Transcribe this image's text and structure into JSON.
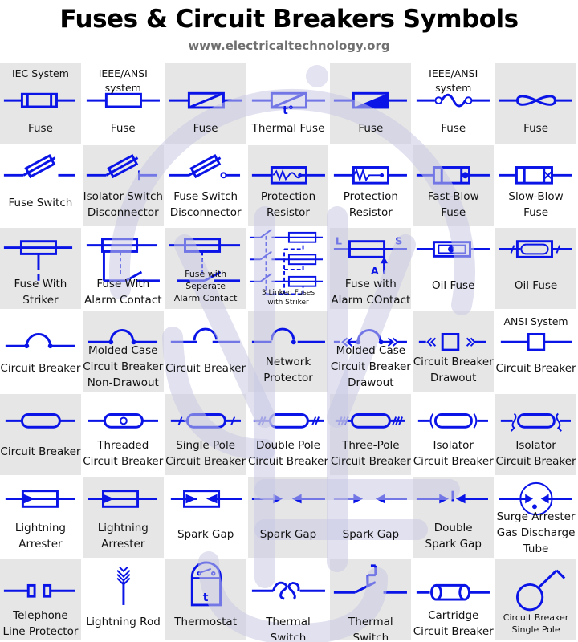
{
  "header": {
    "title": "Fuses & Circuit Breakers Symbols",
    "subtitle": "www.electricaltechnology.org"
  },
  "colors": {
    "symbol_blue": "#0a14e6",
    "cell_gray": "#e6e6e6",
    "cell_white": "#ffffff",
    "watermark": "#d4d4e8",
    "subtitle_gray": "#707070"
  },
  "cells": [
    {
      "icon": "iec-fuse-icon",
      "note": "IEC System",
      "label": "Fuse"
    },
    {
      "icon": "ieee-fuse-icon",
      "note": "IEEE/ANSI\nsystem",
      "label": "Fuse"
    },
    {
      "icon": "diagonal-fuse-icon",
      "note": "",
      "label": "Fuse"
    },
    {
      "icon": "thermal-fuse-icon",
      "note": "",
      "label": "Thermal Fuse",
      "sublabel": "t°"
    },
    {
      "icon": "filled-fuse-icon",
      "note": "",
      "label": "Fuse"
    },
    {
      "icon": "wave-fuse-icon",
      "note": "IEEE/ANSI\nsystem",
      "label": "Fuse"
    },
    {
      "icon": "bowtie-fuse-icon",
      "note": "",
      "label": "Fuse"
    },
    {
      "icon": "fuse-switch-icon",
      "note": "",
      "label": "Fuse Switch"
    },
    {
      "icon": "isolator-switch-icon",
      "note": "",
      "label": "Isolator Switch\nDisconnector"
    },
    {
      "icon": "fuse-switch-disconnector-icon",
      "note": "",
      "label": "Fuse Switch\nDisconnector"
    },
    {
      "icon": "protection-resistor-wave-icon",
      "note": "",
      "label": "Protection\nResistor"
    },
    {
      "icon": "protection-resistor-zigzag-icon",
      "note": "",
      "label": "Protection\nResistor"
    },
    {
      "icon": "fast-blow-fuse-icon",
      "note": "",
      "label": "Fast-Blow\nFuse"
    },
    {
      "icon": "slow-blow-fuse-icon",
      "note": "",
      "label": "Slow-Blow\nFuse"
    },
    {
      "icon": "fuse-striker-icon",
      "note": "",
      "label": "Fuse With\nStriker"
    },
    {
      "icon": "fuse-alarm-contact-icon",
      "note": "",
      "label": "Fuse With\nAlarm Contact"
    },
    {
      "icon": "fuse-separate-alarm-icon",
      "note": "",
      "label": "Fuse with Seperate\nAlarm Contact"
    },
    {
      "icon": "three-linked-fuses-icon",
      "note": "",
      "label": "3 Linked Fuses\nwith Striker"
    },
    {
      "icon": "fuse-alarm-las-icon",
      "note": "",
      "label": "Fuse with\nAlarm COntact",
      "marks": {
        "l": "L",
        "s": "S",
        "a": "A"
      }
    },
    {
      "icon": "oil-fuse-dot-icon",
      "note": "",
      "label": "Oil Fuse"
    },
    {
      "icon": "oil-fuse-rounded-icon",
      "note": "",
      "label": "Oil Fuse"
    },
    {
      "icon": "circuit-breaker-arc-icon",
      "note": "",
      "label": "Circuit Breaker"
    },
    {
      "icon": "molded-case-non-drawout-icon",
      "note": "",
      "label": "Molded Case\nCircuit Breaker\nNon-Drawout"
    },
    {
      "icon": "circuit-breaker-open-arc-icon",
      "note": "",
      "label": "Circuit Breaker"
    },
    {
      "icon": "network-protector-icon",
      "note": "",
      "label": "Network\nProtector"
    },
    {
      "icon": "molded-case-drawout-icon",
      "note": "",
      "label": "Molded Case\nCircuit Breaker\nDrawout"
    },
    {
      "icon": "circuit-breaker-drawout-icon",
      "note": "",
      "label": "Circuit Breaker\nDrawout"
    },
    {
      "icon": "ansi-circuit-breaker-icon",
      "note": "ANSI System",
      "label": "Circuit Breaker"
    },
    {
      "icon": "circuit-breaker-rounded-icon",
      "note": "",
      "label": "Circuit Breaker"
    },
    {
      "icon": "threaded-circuit-breaker-icon",
      "note": "",
      "label": "Threaded\nCircuit Breaker"
    },
    {
      "icon": "single-pole-cb-icon",
      "note": "",
      "label": "Single Pole\nCircuit Breaker"
    },
    {
      "icon": "double-pole-cb-icon",
      "note": "",
      "label": "Double Pole\nCircuit Breaker"
    },
    {
      "icon": "three-pole-cb-icon",
      "note": "",
      "label": "Three-Pole\nCircuit Breaker"
    },
    {
      "icon": "isolator-cb-icon",
      "note": "",
      "label": "Isolator\nCircuit Breaker"
    },
    {
      "icon": "isolator-cb-hooks-icon",
      "note": "",
      "label": "Isolator\nCircuit Breaker"
    },
    {
      "icon": "lightning-arrester-icon",
      "note": "",
      "label": "Lightning\nArrester"
    },
    {
      "icon": "lightning-arrester-2-icon",
      "note": "",
      "label": "Lightning\nArrester"
    },
    {
      "icon": "spark-gap-box-icon",
      "note": "",
      "label": "Spark Gap"
    },
    {
      "icon": "spark-gap-icon",
      "note": "",
      "label": "Spark Gap"
    },
    {
      "icon": "spark-gap-2-icon",
      "note": "",
      "label": "Spark Gap"
    },
    {
      "icon": "double-spark-gap-icon",
      "note": "",
      "label": "Double\nSpark Gap"
    },
    {
      "icon": "surge-arrester-gas-tube-icon",
      "note": "",
      "label": "Surge Arrester\nGas Discharge\nTube"
    },
    {
      "icon": "telephone-line-protector-icon",
      "note": "",
      "label": "Telephone\nLine Protector"
    },
    {
      "icon": "lightning-rod-icon",
      "note": "",
      "label": "Lightning Rod"
    },
    {
      "icon": "thermostat-icon",
      "note": "",
      "label": "Thermostat",
      "sublabel": "t"
    },
    {
      "icon": "thermal-switch-icon",
      "note": "",
      "label": "Thermal Switch"
    },
    {
      "icon": "thermal-switch-2-icon",
      "note": "",
      "label": "Thermal Switch"
    },
    {
      "icon": "cartridge-cb-icon",
      "note": "",
      "label": "Cartridge\nCircuit Breaker"
    },
    {
      "icon": "cb-single-pole-icon",
      "note": "",
      "label": "Circuit Breaker\nSingle Pole"
    }
  ]
}
